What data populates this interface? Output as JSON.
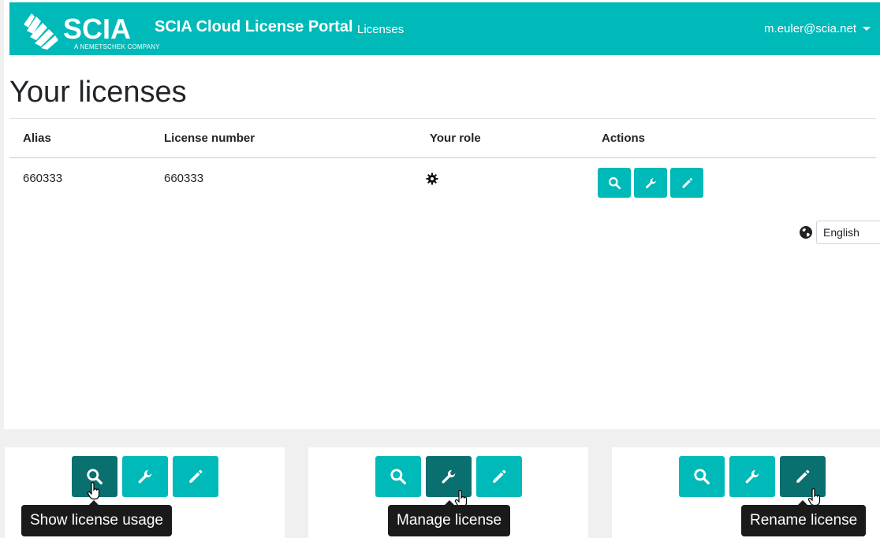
{
  "navbar": {
    "logo_text": "SCIA",
    "logo_sub": "A NEMETSCHEK COMPANY",
    "brand_title": "SCIA Cloud License Portal",
    "nav_link": "Licenses",
    "user": "m.euler@scia.net",
    "bg_color": "#00b9b9"
  },
  "page": {
    "title": "Your licenses"
  },
  "table": {
    "headers": [
      "Alias",
      "License number",
      "Your role",
      "Actions"
    ],
    "rows": [
      {
        "alias": "660333",
        "license_number": "660333",
        "role_icon": "gear-icon",
        "actions": [
          "search-icon",
          "wrench-icon",
          "pencil-icon"
        ]
      }
    ]
  },
  "language": {
    "icon": "globe-icon",
    "selected": "English"
  },
  "panels": [
    {
      "active_action": "search-icon",
      "tooltip": "Show license usage"
    },
    {
      "active_action": "wrench-icon",
      "tooltip": "Manage license"
    },
    {
      "active_action": "pencil-icon",
      "tooltip": "Rename license"
    }
  ],
  "colors": {
    "accent": "#00b9b9",
    "accent_active": "#0a6f6f",
    "tooltip_bg": "#1a1a1a"
  }
}
